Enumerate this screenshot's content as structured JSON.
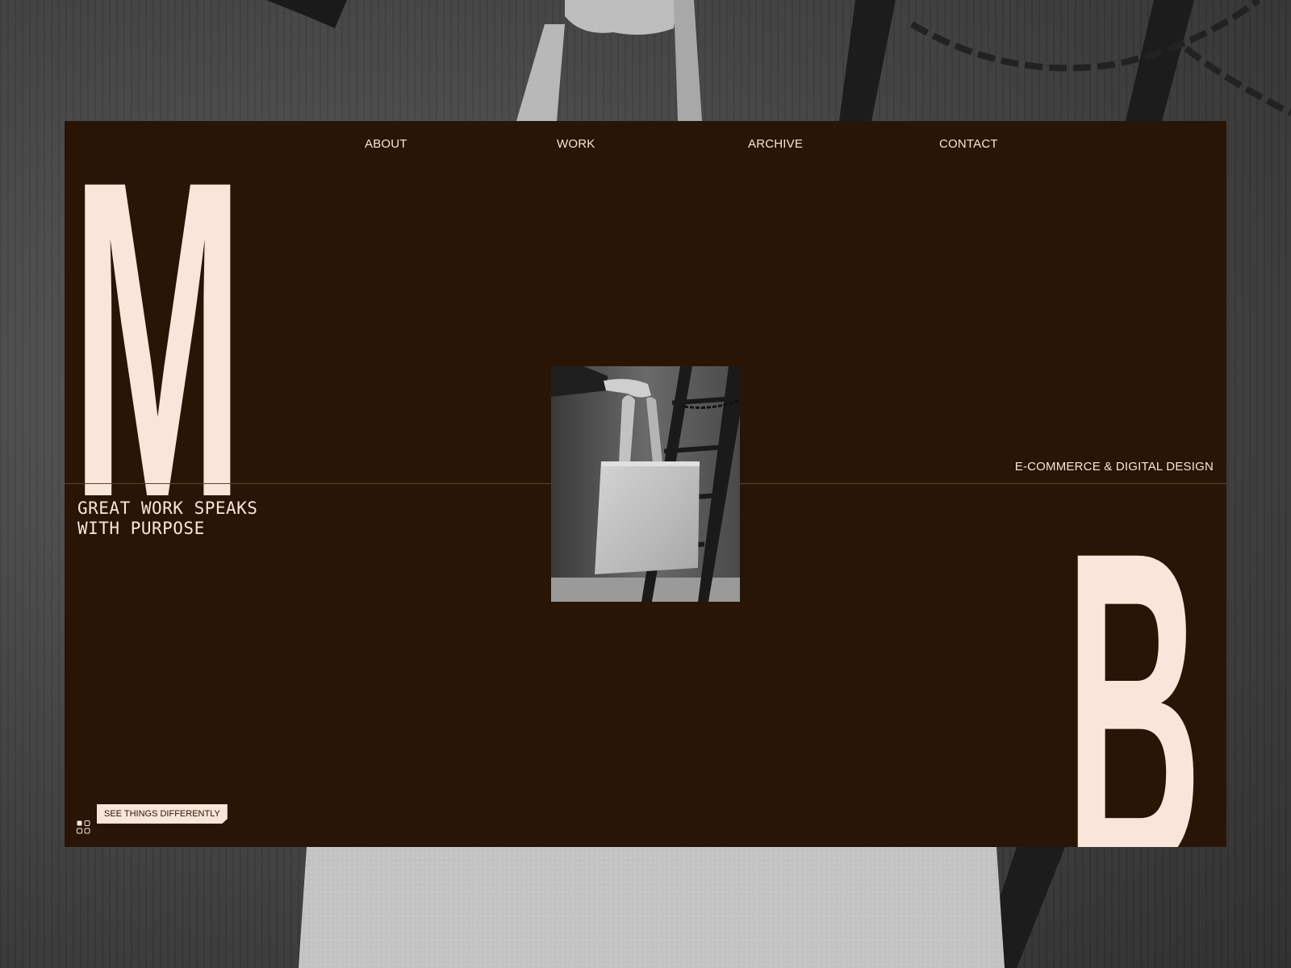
{
  "brand": {
    "letter_left": "M",
    "letter_right": "B"
  },
  "nav": {
    "items": [
      {
        "label": "ABOUT"
      },
      {
        "label": "WORK"
      },
      {
        "label": "ARCHIVE"
      },
      {
        "label": "CONTACT"
      }
    ]
  },
  "hero": {
    "service_label": "E-COMMERCE & DIGITAL DESIGN",
    "headline_line1": "GREAT WORK SPEAKS",
    "headline_line2": "WITH PURPOSE",
    "image_icon": "tote-bag-photo"
  },
  "cta": {
    "label": "SEE THINGS DIFFERENTLY",
    "icon": "grid-icon"
  },
  "colors": {
    "card_background": "#281506",
    "accent_cream": "#f7e6d9",
    "divider": "#5a4330",
    "page_background": "#4a4a4a"
  }
}
